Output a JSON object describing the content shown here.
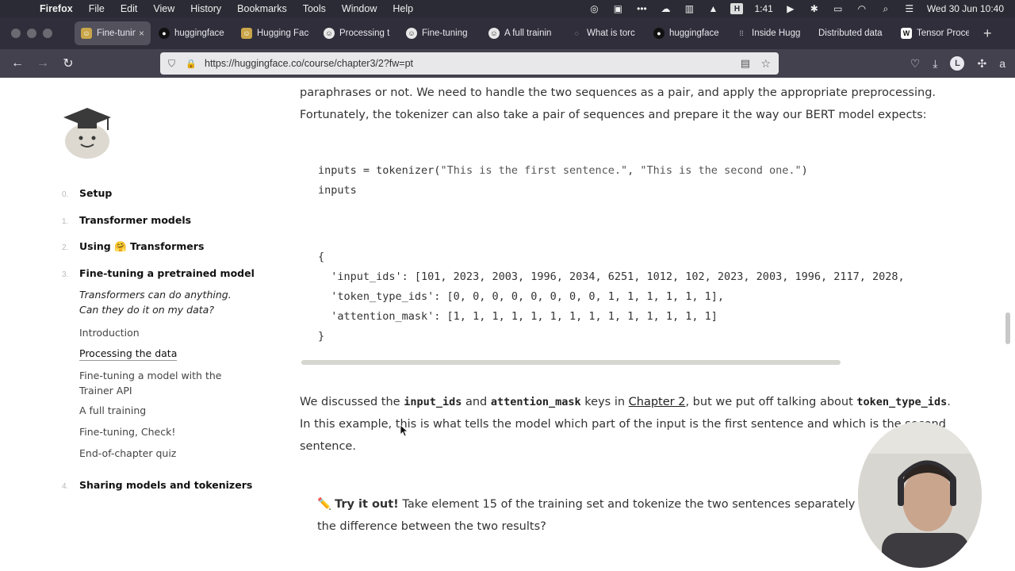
{
  "menubar": {
    "app": "Firefox",
    "items": [
      "File",
      "Edit",
      "View",
      "History",
      "Bookmarks",
      "Tools",
      "Window",
      "Help"
    ],
    "timer": "1:41",
    "datetime": "Wed 30 Jun  10:40"
  },
  "tabs": [
    {
      "title": "Fine-tuning",
      "icon": "hf-icon",
      "active": true
    },
    {
      "title": "huggingface",
      "icon": "github-icon"
    },
    {
      "title": "Hugging Face",
      "icon": "hf-icon"
    },
    {
      "title": "Processing t",
      "icon": "hf-course-icon"
    },
    {
      "title": "Fine-tuning",
      "icon": "hf-course-icon"
    },
    {
      "title": "A full trainin",
      "icon": "hf-course-icon"
    },
    {
      "title": "What is torc",
      "icon": "loading-icon"
    },
    {
      "title": "huggingface",
      "icon": "github-icon"
    },
    {
      "title": "Inside Hugg",
      "icon": "grid-icon"
    },
    {
      "title": "Distributed data",
      "icon": "none"
    },
    {
      "title": "Tensor Proce",
      "icon": "wiki-icon"
    }
  ],
  "address_bar": {
    "url": "https://huggingface.co/course/chapter3/2?fw=pt"
  },
  "sidebar": {
    "chapters": [
      {
        "num": "0.",
        "label": "Setup"
      },
      {
        "num": "1.",
        "label": "Transformer models"
      },
      {
        "num": "2.",
        "label": "Using 🤗 Transformers"
      },
      {
        "num": "3.",
        "label": "Fine-tuning a pretrained model"
      },
      {
        "num": "4.",
        "label": "Sharing models and tokenizers"
      }
    ],
    "sections": [
      {
        "label": "Transformers can do anything. Can they do it on my data?"
      },
      {
        "label": "Introduction"
      },
      {
        "label": "Processing the data"
      },
      {
        "label": "Fine-tuning a model with the Trainer API"
      },
      {
        "label": "A full training"
      },
      {
        "label": "Fine-tuning, Check!"
      },
      {
        "label": "End-of-chapter quiz"
      }
    ]
  },
  "content": {
    "p1_line1": "paraphrases or not. We need to handle the two sequences as a pair, and apply the appropriate preprocessing.",
    "p1_line2": "Fortunately, the tokenizer can also take a pair of sequences and prepare it the way our BERT model expects:",
    "code_in": {
      "line1_a": "inputs = tokenizer(",
      "line1_s1": "\"This is the first sentence.\"",
      "line1_sep": ", ",
      "line1_s2": "\"This is the second one.\"",
      "line1_b": ")",
      "line2": "inputs"
    },
    "code_out": {
      "open": "{",
      "input_ids": "  'input_ids': [101, 2023, 2003, 1996, 2034, 6251, 1012, 102, 2023, 2003, 1996, 2117, 2028,",
      "token_type_ids": "  'token_type_ids': [0, 0, 0, 0, 0, 0, 0, 0, 1, 1, 1, 1, 1, 1],",
      "attention_mask": "  'attention_mask': [1, 1, 1, 1, 1, 1, 1, 1, 1, 1, 1, 1, 1, 1]",
      "close": "}"
    },
    "p2": {
      "a": "We discussed the ",
      "k1": "input_ids",
      "b": " and ",
      "k2": "attention_mask",
      "c": " keys in ",
      "link": "Chapter 2",
      "d": ", but we put off talking about ",
      "k3": "token_type_ids",
      "e": "."
    },
    "p2_line2": "In this example, this is what tells the model which part of the input is the first sentence and which is the second",
    "p2_line3": "sentence.",
    "tip": {
      "label": "Try it out!",
      "text1": " Take element 15 of the training set and tokenize the two sentences separately and as a pa",
      "text2": "the difference between the two results?"
    }
  }
}
